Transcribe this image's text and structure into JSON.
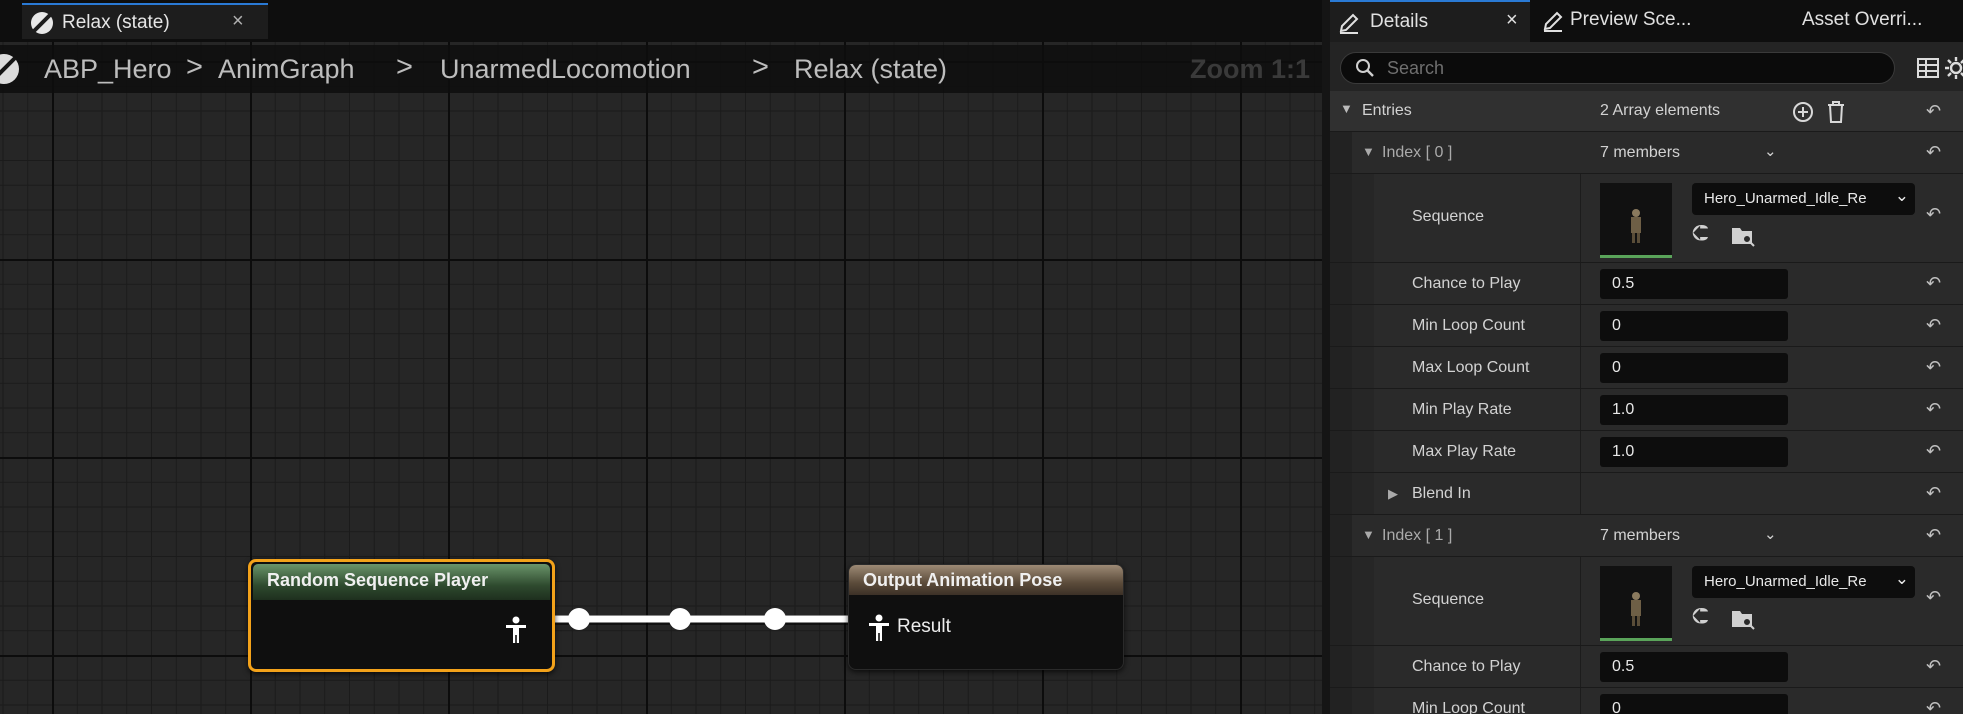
{
  "graph_tab": {
    "label": "Relax (state)",
    "close": "×"
  },
  "breadcrumb": {
    "items": [
      "ABP_Hero",
      "AnimGraph",
      "UnarmedLocomotion",
      "Relax (state)"
    ],
    "separator": ">"
  },
  "zoom_label": "Zoom 1:1",
  "nodes": {
    "random_sequence_player": {
      "title": "Random Sequence Player"
    },
    "output_animation_pose": {
      "title": "Output Animation Pose",
      "pin_label": "Result"
    }
  },
  "right_tabs": {
    "details": {
      "label": "Details",
      "close": "×"
    },
    "preview": {
      "label": "Preview Sce..."
    },
    "asset_overrides": {
      "label": "Asset Overri..."
    }
  },
  "search": {
    "placeholder": "Search"
  },
  "entries": {
    "label": "Entries",
    "summary": "2 Array elements"
  },
  "index0": {
    "label": "Index [ 0 ]",
    "members": "7 members",
    "sequence_label": "Sequence",
    "sequence_value": "Hero_Unarmed_Idle_Re",
    "chance_label": "Chance to Play",
    "chance_value": "0.5",
    "min_loop_label": "Min Loop Count",
    "min_loop_value": "0",
    "max_loop_label": "Max Loop Count",
    "max_loop_value": "0",
    "min_rate_label": "Min Play Rate",
    "min_rate_value": "1.0",
    "max_rate_label": "Max Play Rate",
    "max_rate_value": "1.0",
    "blend_in_label": "Blend In"
  },
  "index1": {
    "label": "Index [ 1 ]",
    "members": "7 members",
    "sequence_label": "Sequence",
    "sequence_value": "Hero_Unarmed_Idle_Re",
    "chance_label": "Chance to Play",
    "chance_value": "0.5",
    "min_loop_label": "Min Loop Count",
    "min_loop_value": "0"
  },
  "colors": {
    "selection_outline": "#f3a21a",
    "tab_accent": "#2a7ad5",
    "sequence_thumb_bar": "#5aa45a"
  }
}
